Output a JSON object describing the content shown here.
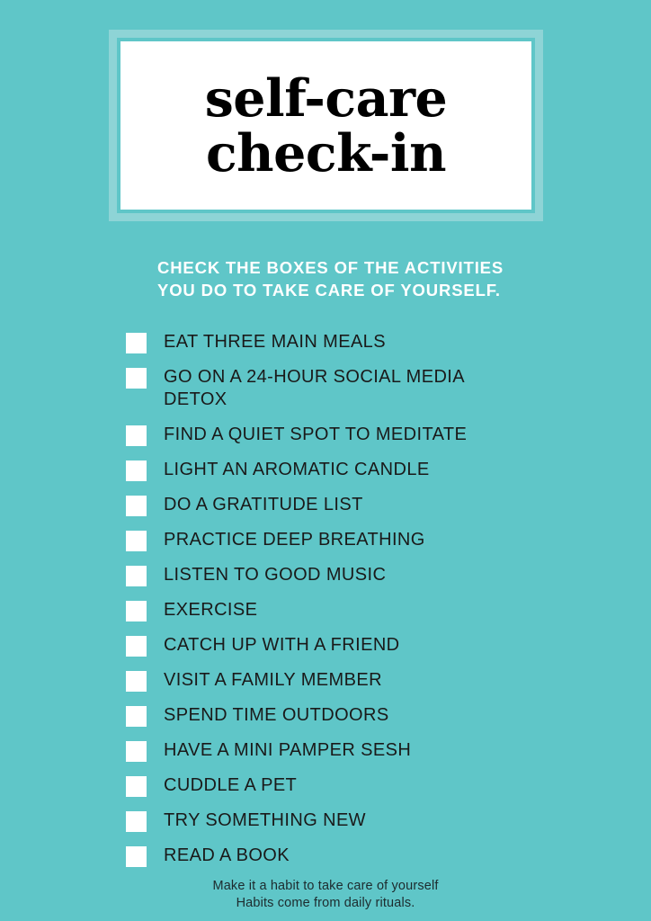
{
  "theme": {
    "background_color": "#5fc6c8",
    "frame_color": "#8ed4d6",
    "card_color": "#ffffff",
    "text_color": "#1a1a1a",
    "subtitle_color": "#ffffff",
    "checkbox_color": "#ffffff"
  },
  "title": {
    "line1": "self-care",
    "line2": "check-in"
  },
  "subtitle": {
    "line1": "CHECK THE BOXES OF THE ACTIVITIES",
    "line2": "YOU DO TO TAKE CARE OF YOURSELF."
  },
  "checklist": [
    {
      "label": "EAT THREE MAIN MEALS",
      "checked": false
    },
    {
      "label": "GO ON A 24-HOUR SOCIAL MEDIA DETOX",
      "checked": false
    },
    {
      "label": "FIND A QUIET SPOT TO MEDITATE",
      "checked": false
    },
    {
      "label": "LIGHT AN AROMATIC CANDLE",
      "checked": false
    },
    {
      "label": "DO A GRATITUDE LIST",
      "checked": false
    },
    {
      "label": "PRACTICE DEEP BREATHING",
      "checked": false
    },
    {
      "label": "LISTEN TO GOOD MUSIC",
      "checked": false
    },
    {
      "label": "EXERCISE",
      "checked": false
    },
    {
      "label": "CATCH UP WITH A FRIEND",
      "checked": false
    },
    {
      "label": "VISIT A FAMILY MEMBER",
      "checked": false
    },
    {
      "label": "SPEND TIME OUTDOORS",
      "checked": false
    },
    {
      "label": "HAVE A MINI PAMPER SESH",
      "checked": false
    },
    {
      "label": "CUDDLE A PET",
      "checked": false
    },
    {
      "label": "TRY SOMETHING NEW",
      "checked": false
    },
    {
      "label": "READ A BOOK",
      "checked": false
    }
  ],
  "footer": {
    "line1": "Make it a habit to take care of yourself",
    "line2": "Habits come from daily rituals."
  }
}
